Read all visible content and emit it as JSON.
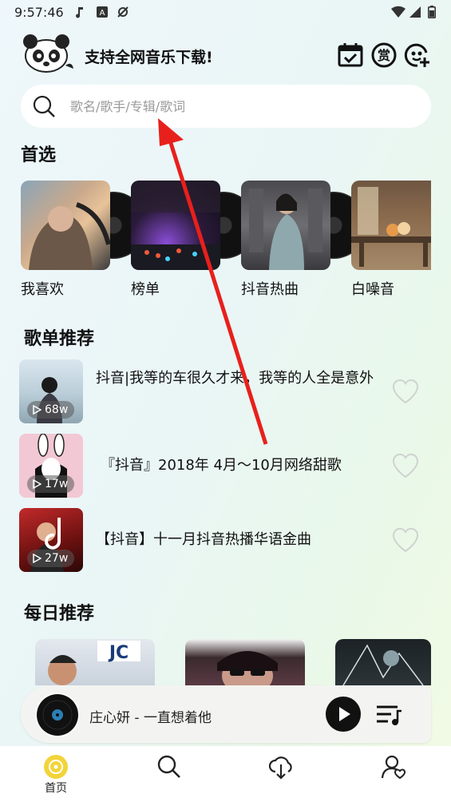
{
  "status_bar": {
    "time": "9:57:46"
  },
  "header": {
    "title": "支持全网音乐下载!"
  },
  "search": {
    "placeholder": "歌名/歌手/专辑/歌词"
  },
  "featured": {
    "title": "首选",
    "items": [
      {
        "label": "我喜欢"
      },
      {
        "label": "榜单"
      },
      {
        "label": "抖音热曲"
      },
      {
        "label": "白噪音"
      }
    ]
  },
  "playlists": {
    "title": "歌单推荐",
    "items": [
      {
        "name": "抖音|我等的车很久才来，我等的人全是意外",
        "plays": "68w"
      },
      {
        "name": "『抖音』2018年 4月～10月网络甜歌",
        "plays": "17w"
      },
      {
        "name": "【抖音】十一月抖音热播华语金曲",
        "plays": "27w"
      }
    ]
  },
  "daily": {
    "title": "每日推荐"
  },
  "player": {
    "now_playing": "庄心妍 - 一直想着他"
  },
  "tabbar": {
    "tabs": [
      {
        "label": "首页",
        "active": true
      },
      {
        "label": "",
        "icon": "search-icon"
      },
      {
        "label": "",
        "icon": "download-icon"
      },
      {
        "label": "",
        "icon": "profile-icon"
      }
    ]
  },
  "colors": {
    "accent": "#f2d43a",
    "annotation_arrow": "#e8201c"
  }
}
